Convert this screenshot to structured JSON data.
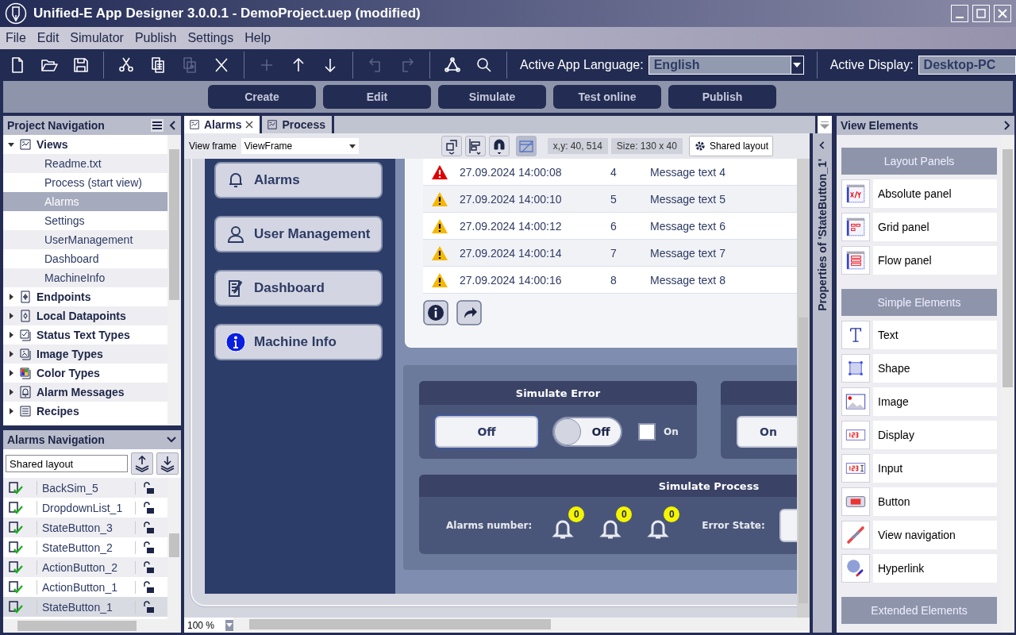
{
  "window": {
    "title": "Unified-E App Designer 3.0.0.1 - DemoProject.uep  (modified)"
  },
  "menu": [
    "File",
    "Edit",
    "Simulator",
    "Publish",
    "Settings",
    "Help"
  ],
  "toolbar": [
    {
      "kind": "new",
      "disabled": false
    },
    {
      "kind": "open",
      "disabled": false
    },
    {
      "kind": "save",
      "disabled": false
    },
    {
      "kind": "separator"
    },
    {
      "kind": "cut",
      "disabled": false
    },
    {
      "kind": "copy",
      "disabled": false
    },
    {
      "kind": "paste",
      "disabled": true
    },
    {
      "kind": "delete",
      "disabled": false
    },
    {
      "kind": "separator"
    },
    {
      "kind": "add",
      "disabled": true
    },
    {
      "kind": "up",
      "disabled": false
    },
    {
      "kind": "down",
      "disabled": false
    },
    {
      "kind": "separator"
    },
    {
      "kind": "undo",
      "disabled": true
    },
    {
      "kind": "redo",
      "disabled": true
    },
    {
      "kind": "separator"
    },
    {
      "kind": "graph",
      "disabled": false
    },
    {
      "kind": "search",
      "disabled": false
    }
  ],
  "language": {
    "label": "Active App Language:",
    "value": "English"
  },
  "display": {
    "label": "Active Display:",
    "value": "Desktop-PC"
  },
  "modes": [
    "Create",
    "Edit",
    "Simulate",
    "Test online",
    "Publish"
  ],
  "project_navigation": {
    "title": "Project Navigation",
    "tree": [
      {
        "label": "Views",
        "kind": "views",
        "expanded": true,
        "children": [
          {
            "label": "Readme.txt",
            "selected": false
          },
          {
            "label": "Process (start view)",
            "selected": false
          },
          {
            "label": "Alarms",
            "selected": true
          },
          {
            "label": "Settings",
            "selected": false
          },
          {
            "label": "UserManagement",
            "selected": false
          },
          {
            "label": "Dashboard",
            "selected": false
          },
          {
            "label": "MachineInfo",
            "selected": false
          }
        ]
      },
      {
        "label": "Endpoints",
        "kind": "endpoints",
        "expanded": false
      },
      {
        "label": "Local Datapoints",
        "kind": "datapoints",
        "expanded": false
      },
      {
        "label": "Status Text Types",
        "kind": "status",
        "expanded": false
      },
      {
        "label": "Image Types",
        "kind": "image",
        "expanded": false
      },
      {
        "label": "Color Types",
        "kind": "color",
        "expanded": false
      },
      {
        "label": "Alarm Messages",
        "kind": "alarm",
        "expanded": false
      },
      {
        "label": "Recipes",
        "kind": "recipes",
        "expanded": false
      }
    ]
  },
  "alarms_navigation": {
    "title": "Alarms Navigation",
    "layout": "Shared layout",
    "items": [
      {
        "label": "BackSim_5",
        "selected": false
      },
      {
        "label": "DropdownList_1",
        "selected": false
      },
      {
        "label": "StateButton_3",
        "selected": false
      },
      {
        "label": "StateButton_2",
        "selected": false
      },
      {
        "label": "ActionButton_2",
        "selected": false
      },
      {
        "label": "ActionButton_1",
        "selected": false
      },
      {
        "label": "StateButton_1",
        "selected": true
      }
    ]
  },
  "editor": {
    "tabs": [
      {
        "label": "Alarms",
        "selected": true
      },
      {
        "label": "Process",
        "selected": false
      }
    ],
    "view_frame": {
      "label": "View frame",
      "value": "ViewFrame"
    },
    "position": "x,y: 40, 514",
    "size": "Size: 130 x 40",
    "shared_layout": "Shared layout",
    "zoom": "100 %"
  },
  "canvas": {
    "nav_buttons": [
      {
        "label": "Alarms",
        "kind": "bell"
      },
      {
        "label": "User Management",
        "kind": "user"
      },
      {
        "label": "Dashboard",
        "kind": "clipboard"
      },
      {
        "label": "Machine Info",
        "kind": "info"
      }
    ],
    "alarm_rows": [
      {
        "critical": true,
        "time": "27.09.2024 14:00:08",
        "number": "4",
        "message": "Message text 4"
      },
      {
        "critical": false,
        "time": "27.09.2024 14:00:10",
        "number": "5",
        "message": "Message text 5"
      },
      {
        "critical": false,
        "time": "27.09.2024 14:00:12",
        "number": "6",
        "message": "Message text 6"
      },
      {
        "critical": false,
        "time": "27.09.2024 14:00:14",
        "number": "7",
        "message": "Message text 7"
      },
      {
        "critical": false,
        "time": "27.09.2024 14:00:16",
        "number": "8",
        "message": "Message text 8"
      }
    ],
    "error_panel": {
      "title": "Simulate Error",
      "state_button": {
        "label": "Off",
        "selected": true
      },
      "toggle": {
        "label": "Off",
        "on": false
      },
      "checkbox": {
        "label": "On",
        "checked": false
      }
    },
    "second_panel": {
      "button": "On"
    },
    "process_panel": {
      "title": "Simulate Process",
      "alarms_label": "Alarms number:",
      "counters": [
        "0",
        "0",
        "0"
      ],
      "error_state_label": "Error State:"
    }
  },
  "properties": {
    "title": "Properties of 'StateButton_1'"
  },
  "view_elements": {
    "title": "View Elements",
    "groups": [
      {
        "title": "Layout Panels",
        "items": [
          {
            "label": "Absolute panel",
            "kind": "absolute"
          },
          {
            "label": "Grid panel",
            "kind": "grid"
          },
          {
            "label": "Flow panel",
            "kind": "flow"
          }
        ]
      },
      {
        "title": "Simple Elements",
        "items": [
          {
            "label": "Text",
            "kind": "text"
          },
          {
            "label": "Shape",
            "kind": "shape"
          },
          {
            "label": "Image",
            "kind": "image"
          },
          {
            "label": "Display",
            "kind": "display"
          },
          {
            "label": "Input",
            "kind": "input"
          },
          {
            "label": "Button",
            "kind": "button"
          },
          {
            "label": "View navigation",
            "kind": "link"
          },
          {
            "label": "Hyperlink",
            "kind": "hyperlink"
          }
        ]
      },
      {
        "title": "Extended Elements"
      }
    ]
  }
}
